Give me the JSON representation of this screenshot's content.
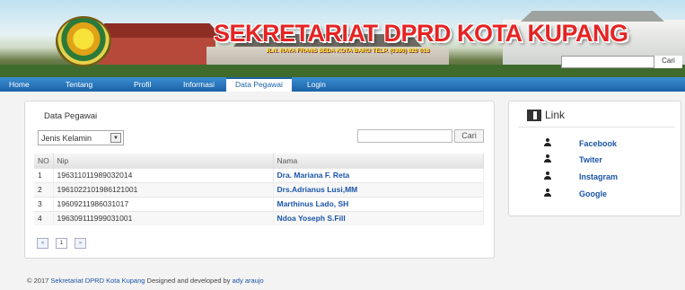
{
  "header": {
    "title": "SEKRETARIAT DPRD KOTA KUPANG",
    "subtitle": "JLN. RAYA FRANS SEDA KOTA BARU TELP. (0380) 820 018",
    "search_button": "Cari"
  },
  "nav": {
    "items": [
      {
        "label": "Home"
      },
      {
        "label": "Tentang"
      },
      {
        "label": "Profil"
      },
      {
        "label": "Informasi"
      },
      {
        "label": "Data Pegawai"
      },
      {
        "label": "Login"
      }
    ],
    "active": "Data Pegawai"
  },
  "main": {
    "panel_title": "Data Pegawai",
    "filter_value": "Jenis Kelamin",
    "search_button": "Cari",
    "table": {
      "columns": [
        "NO",
        "Nip",
        "Nama"
      ],
      "rows": [
        [
          "1",
          "196311011989032014",
          "Dra. Mariana F. Reta"
        ],
        [
          "2",
          "1961022101986121001",
          "Drs.Adrianus Lusi,MM"
        ],
        [
          "3",
          "19609211986031017",
          "Marthinus Lado, SH"
        ],
        [
          "4",
          "196309111999031001",
          "Ndoa Yoseph S.Fill"
        ]
      ]
    },
    "pagination": {
      "prev": "«",
      "page": "1",
      "next": "»"
    }
  },
  "sidebar": {
    "title": "Link",
    "links": [
      {
        "label": "Facebook"
      },
      {
        "label": "Twiter"
      },
      {
        "label": "Instagram"
      },
      {
        "label": "Google"
      }
    ]
  },
  "footer": {
    "copyright": "© 2017",
    "org_link": "Sekretariat DPRD Kota Kupang",
    "designed_text": "Designed and developed by",
    "author_link": "ady araujo"
  },
  "colors": {
    "nav_blue": "#1b62a8",
    "title_red": "#e52323",
    "link_blue": "#1a55a8"
  }
}
